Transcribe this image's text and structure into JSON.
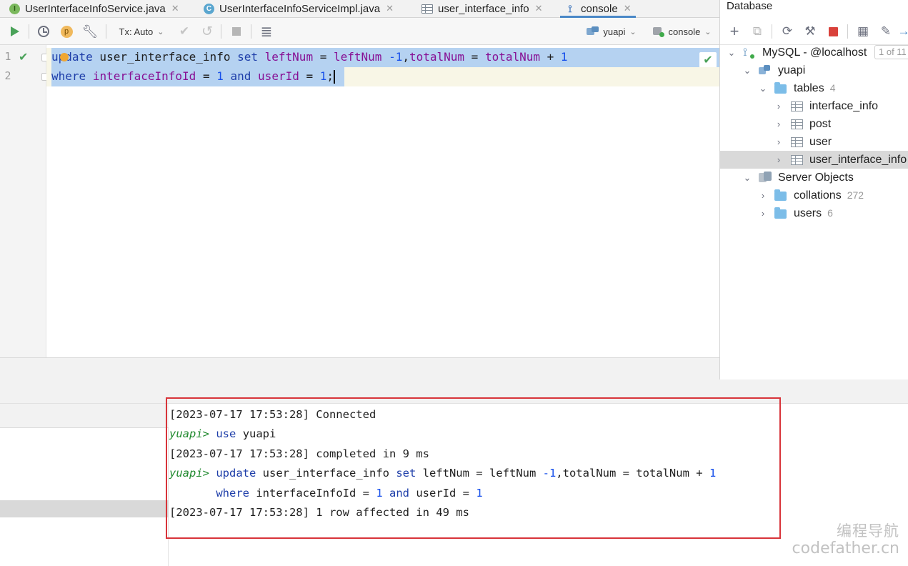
{
  "tabs": [
    {
      "label": "UserInterfaceInfoService.java",
      "icon": "interface-icon",
      "icon_glyph": "I",
      "close": "✕"
    },
    {
      "label": "UserInterfaceInfoServiceImpl.java",
      "icon": "class-icon",
      "icon_glyph": "C",
      "close": "✕"
    },
    {
      "label": "user_interface_info",
      "icon": "table-icon",
      "close": "✕"
    },
    {
      "label": "console",
      "icon": "console-icon",
      "icon_glyph": "⟟",
      "close": "✕",
      "active": true
    }
  ],
  "toolbar": {
    "run_icon": "run-icon",
    "history_icon": "history-icon",
    "p_badge": "p",
    "settings_icon": "wrench-icon",
    "tx_label": "Tx: Auto",
    "chevron": "⌄",
    "commit_icon": "✔",
    "rollback_icon": "↺",
    "stop_icon": "stop-icon",
    "format_icon": "≣",
    "schema_label": "yuapi",
    "session_label": "console"
  },
  "editor": {
    "line_numbers": [
      "1",
      "2"
    ],
    "gutter_check": "✔",
    "ok_check": "✔"
  },
  "database": {
    "title": "Database",
    "toolbar_icons": [
      "+",
      "⧉",
      "⟳",
      "⚒",
      "stop-icon",
      "▦",
      "✎",
      "→"
    ],
    "pager": "1 of 11",
    "tree": [
      {
        "label": "MySQL - @localhost",
        "count": "",
        "expanded": true,
        "icon": "mysql-icon"
      },
      {
        "label": "yuapi",
        "count": "",
        "expanded": true,
        "icon": "schema-icon"
      },
      {
        "label": "tables",
        "count": "4",
        "expanded": true,
        "icon": "folder-icon"
      },
      {
        "label": "interface_info",
        "count": "",
        "expanded": false,
        "icon": "table-icon"
      },
      {
        "label": "post",
        "count": "",
        "expanded": false,
        "icon": "table-icon"
      },
      {
        "label": "user",
        "count": "",
        "expanded": false,
        "icon": "table-icon"
      },
      {
        "label": "user_interface_info",
        "count": "",
        "expanded": false,
        "icon": "table-icon",
        "selected": true
      },
      {
        "label": "Server Objects",
        "count": "",
        "expanded": true,
        "icon": "server-objects-icon"
      },
      {
        "label": "collations",
        "count": "272",
        "expanded": false,
        "icon": "folder-icon"
      },
      {
        "label": "users",
        "count": "6",
        "expanded": false,
        "icon": "folder-icon"
      }
    ]
  },
  "console": {
    "line1": "[2023-07-17 17:53:28] Connected",
    "prompt": "yuapi>",
    "use_kw": "use",
    "use_arg": "yuapi",
    "line3": "[2023-07-17 17:53:28] completed in 9 ms",
    "line6": "[2023-07-17 17:53:28] 1 row affected in 49 ms"
  },
  "watermark": {
    "cn": "编程导航",
    "en": "codefather.cn"
  },
  "colors": {
    "keyword": "#1e3ea9",
    "field": "#871094",
    "number": "#1750eb",
    "prompt": "#218a2f",
    "highlight_box": "#d8343a",
    "selection": "#b5d2f1"
  }
}
